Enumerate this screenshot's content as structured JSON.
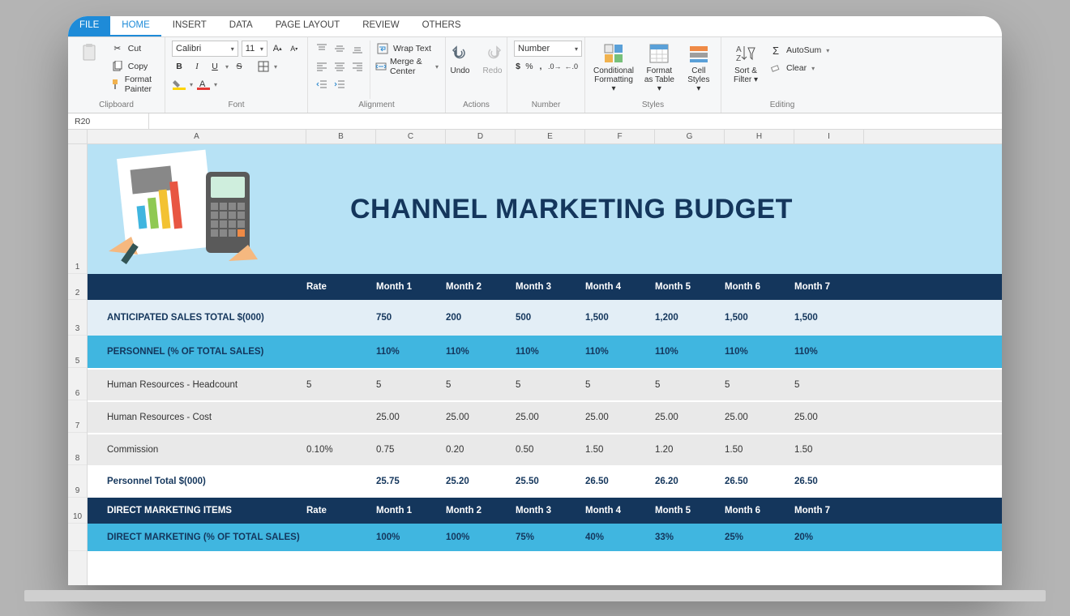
{
  "tabs": {
    "file": "FILE",
    "home": "HOME",
    "insert": "INSERT",
    "data": "DATA",
    "page": "PAGE LAYOUT",
    "review": "REVIEW",
    "others": "OTHERS"
  },
  "ribbon": {
    "clipboard": {
      "cut": "Cut",
      "copy": "Copy",
      "format": "Format Painter",
      "title": "Clipboard"
    },
    "font": {
      "family": "Calibri",
      "size": "11",
      "title": "Font"
    },
    "alignment": {
      "wrap": "Wrap Text",
      "merge": "Merge & Center",
      "title": "Alignment"
    },
    "actions": {
      "undo": "Undo",
      "redo": "Redo",
      "title": "Actions"
    },
    "number": {
      "format": "Number",
      "title": "Number"
    },
    "styles": {
      "cond": "Conditional Formatting ▾",
      "fmt": "Format as Table ▾",
      "cell": "Cell Styles ▾",
      "title": "Styles"
    },
    "editing": {
      "sort": "Sort & Filter ▾",
      "autosum": "AutoSum",
      "clear": "Clear",
      "title": "Editing"
    }
  },
  "namebox": "R20",
  "cols": {
    "a": "A",
    "b": "B",
    "c": "C",
    "d": "D",
    "e": "E",
    "f": "F",
    "g": "G",
    "h": "H",
    "i": "I"
  },
  "banner": "CHANNEL MARKETING BUDGET",
  "headers": {
    "rate": "Rate",
    "m1": "Month 1",
    "m2": "Month 2",
    "m3": "Month 3",
    "m4": "Month 4",
    "m5": "Month 5",
    "m6": "Month 6",
    "m7": "Month 7"
  },
  "rows": {
    "anticipated": {
      "label": "ANTICIPATED SALES TOTAL $(000)",
      "rate": "",
      "m": [
        "750",
        "200",
        "500",
        "1,500",
        "1,200",
        "1,500",
        "1,500"
      ]
    },
    "personnel": {
      "label": "PERSONNEL (% OF TOTAL SALES)",
      "rate": "",
      "m": [
        "110%",
        "110%",
        "110%",
        "110%",
        "110%",
        "110%",
        "110%"
      ]
    },
    "hrHead": {
      "label": "Human Resources - Headcount",
      "rate": "5",
      "m": [
        "5",
        "5",
        "5",
        "5",
        "5",
        "5",
        "5"
      ]
    },
    "hrCost": {
      "label": "Human Resources - Cost",
      "rate": "",
      "m": [
        "25.00",
        "25.00",
        "25.00",
        "25.00",
        "25.00",
        "25.00",
        "25.00"
      ]
    },
    "commission": {
      "label": "Commission",
      "rate": "0.10%",
      "m": [
        "0.75",
        "0.20",
        "0.50",
        "1.50",
        "1.20",
        "1.50",
        "1.50"
      ]
    },
    "ptotal": {
      "label": "Personnel Total $(000)",
      "rate": "",
      "m": [
        "25.75",
        "25.20",
        "25.50",
        "26.50",
        "26.20",
        "26.50",
        "26.50"
      ]
    },
    "dmi": {
      "label": "DIRECT MARKETING ITEMS",
      "rate": "Rate",
      "m": [
        "Month 1",
        "Month 2",
        "Month 3",
        "Month 4",
        "Month 5",
        "Month 6",
        "Month 7"
      ]
    },
    "dmpct": {
      "label": "DIRECT MARKETING (% OF TOTAL SALES)",
      "rate": "",
      "m": [
        "100%",
        "100%",
        "75%",
        "40%",
        "33%",
        "25%",
        "20%"
      ]
    }
  },
  "rownums": [
    "1",
    "2",
    "3",
    "",
    "5",
    "6",
    "7",
    "8",
    "9",
    "10",
    ""
  ]
}
